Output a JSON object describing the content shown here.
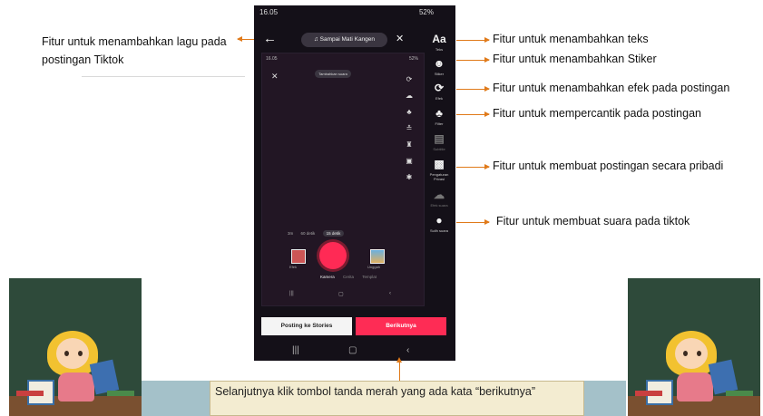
{
  "annotations": {
    "left": "Fitur untuk menambahkan lagu pada postingan Tiktok",
    "right": [
      "Fitur untuk menambahkan teks",
      "Fitur untuk menambahkan Stiker",
      "Fitur untuk menambahkan efek pada postingan",
      "Fitur untuk mempercantik pada postingan",
      "Fitur untuk membuat postingan secara pribadi",
      "Fitur untuk membuat suara pada tiktok"
    ]
  },
  "phone": {
    "status_time": "16.05",
    "status_right": "52%",
    "sound_label": "Sampai Mati Kangen",
    "inner_status_right": "52%",
    "inner_sound": "Tambahkan suara",
    "mode_options": [
      "3m",
      "60 detik",
      "15 detik"
    ],
    "effects_label": "Efek",
    "upload_label": "Unggah",
    "inner_tabs": [
      "Kamera",
      "Cerita",
      "Templat"
    ],
    "side_tools": [
      {
        "icon": "text-icon",
        "glyph": "Aa",
        "label": "Teks"
      },
      {
        "icon": "sticker-icon",
        "glyph": "☻",
        "label": "Stiker"
      },
      {
        "icon": "effects-icon",
        "glyph": "⟳",
        "label": "Efek"
      },
      {
        "icon": "filters-icon",
        "glyph": "♣",
        "label": "Filter"
      },
      {
        "icon": "subtitle-icon",
        "glyph": "▤",
        "label": "Subtitle"
      },
      {
        "icon": "lock-icon",
        "glyph": "🔒",
        "label": "Pengaturan Privasi"
      },
      {
        "icon": "voice-effect-icon",
        "glyph": "☁",
        "label": "Efek suara"
      },
      {
        "icon": "microphone-icon",
        "glyph": "🎙",
        "label": "Sulih suara"
      }
    ],
    "post_to_stories": "Posting ke Stories",
    "next_button": "Berikutnya"
  },
  "callout": {
    "text": "Selanjutnya klik tombol tanda merah yang ada kata “berikutnya”"
  },
  "colors": {
    "accent_red": "#fe2c55",
    "arrow_orange": "#e07a1a",
    "band_orange": "#e0611c",
    "callout_bg": "#f3ecd1"
  }
}
